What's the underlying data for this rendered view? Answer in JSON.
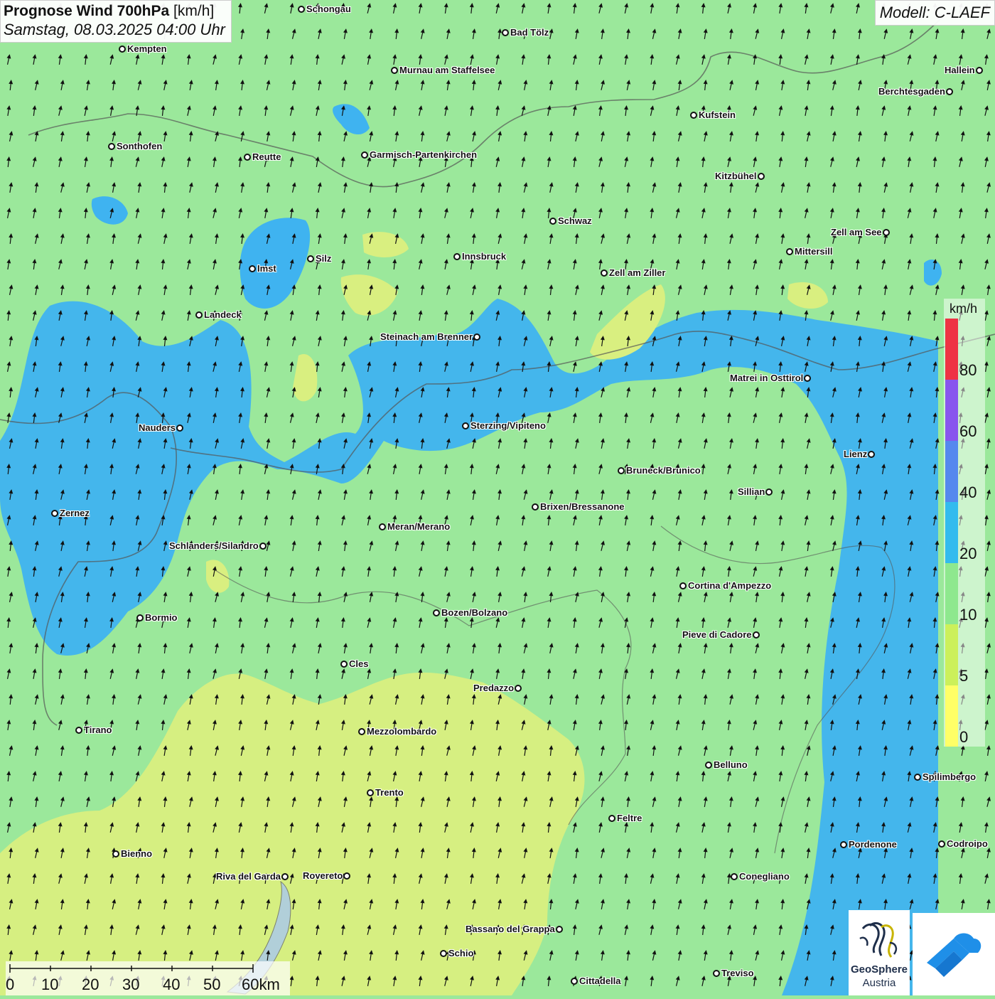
{
  "header": {
    "title_bold": "Prognose Wind 700hPa",
    "title_unit": "[km/h]",
    "datetime": "Samstag, 08.03.2025 04:00 Uhr",
    "model": "Modell: C-LAEF"
  },
  "colors": {
    "background_field": "#9be89b",
    "band_blue": "#3fb3f0",
    "band_yellow": "#d9ef80",
    "legend": [
      "#ffff66",
      "#ccf05a",
      "#8ee88e",
      "#33bbee",
      "#5588ee",
      "#8855ee",
      "#ee3344"
    ]
  },
  "cities": [
    {
      "name": "Schongau",
      "side": "r"
    },
    {
      "name": "Bad Tölz",
      "side": "r"
    },
    {
      "name": "Kempten",
      "side": "r"
    },
    {
      "name": "Murnau am Staffelsee",
      "side": "r"
    },
    {
      "name": "Hallein",
      "side": "l"
    },
    {
      "name": "Berchtesgaden",
      "side": "l"
    },
    {
      "name": "Kufstein",
      "side": "r"
    },
    {
      "name": "Sonthofen",
      "side": "r"
    },
    {
      "name": "Reutte",
      "side": "r"
    },
    {
      "name": "Garmisch-Partenkirchen",
      "side": "r"
    },
    {
      "name": "Kitzbühel",
      "side": "l"
    },
    {
      "name": "Schwaz",
      "side": "r"
    },
    {
      "name": "Zell am See",
      "side": "l"
    },
    {
      "name": "Mittersill",
      "side": "r"
    },
    {
      "name": "Innsbruck",
      "side": "r"
    },
    {
      "name": "Silz",
      "side": "r"
    },
    {
      "name": "Imst",
      "side": "r"
    },
    {
      "name": "Zell am Ziller",
      "side": "r"
    },
    {
      "name": "Landeck",
      "side": "r"
    },
    {
      "name": "Steinach am Brenner",
      "side": "l"
    },
    {
      "name": "Matrei in Osttirol",
      "side": "l"
    },
    {
      "name": "Nauders",
      "side": "l"
    },
    {
      "name": "Sterzing/Vipiteno",
      "side": "r"
    },
    {
      "name": "Lienz",
      "side": "l"
    },
    {
      "name": "Bruneck/Brunico",
      "side": "r"
    },
    {
      "name": "Sillian",
      "side": "l"
    },
    {
      "name": "Brixen/Bressanone",
      "side": "r"
    },
    {
      "name": "Zernez",
      "side": "r"
    },
    {
      "name": "Meran/Merano",
      "side": "r"
    },
    {
      "name": "Schlanders/Silandro",
      "side": "l"
    },
    {
      "name": "Cortina d'Ampezzo",
      "side": "r"
    },
    {
      "name": "Bozen/Bolzano",
      "side": "r"
    },
    {
      "name": "Bormio",
      "side": "r"
    },
    {
      "name": "Pieve di Cadore",
      "side": "l"
    },
    {
      "name": "Cles",
      "side": "r"
    },
    {
      "name": "Predazzo",
      "side": "l"
    },
    {
      "name": "Tirano",
      "side": "r"
    },
    {
      "name": "Mezzolombardo",
      "side": "r"
    },
    {
      "name": "Belluno",
      "side": "r"
    },
    {
      "name": "Spilimbergo",
      "side": "r"
    },
    {
      "name": "Trento",
      "side": "r"
    },
    {
      "name": "Feltre",
      "side": "r"
    },
    {
      "name": "Pordenone",
      "side": "r"
    },
    {
      "name": "Codroipo",
      "side": "r"
    },
    {
      "name": "Bienno",
      "side": "r"
    },
    {
      "name": "Riva del Garda",
      "side": "l"
    },
    {
      "name": "Rovereto",
      "side": "l"
    },
    {
      "name": "Conegliano",
      "side": "r"
    },
    {
      "name": "Bassano del Grappa",
      "side": "l"
    },
    {
      "name": "Schio",
      "side": "r"
    },
    {
      "name": "Treviso",
      "side": "r"
    },
    {
      "name": "Cittadella",
      "side": "r"
    }
  ],
  "legend": {
    "unit": "km/h",
    "ticks": [
      "80",
      "60",
      "40",
      "20",
      "10",
      "5",
      "0"
    ]
  },
  "scale": {
    "labels": [
      "0",
      "10",
      "20",
      "30",
      "40",
      "50",
      "60km"
    ]
  },
  "logos": {
    "geosphere_name": "GeoSphere",
    "geosphere_sub": "Austria"
  }
}
